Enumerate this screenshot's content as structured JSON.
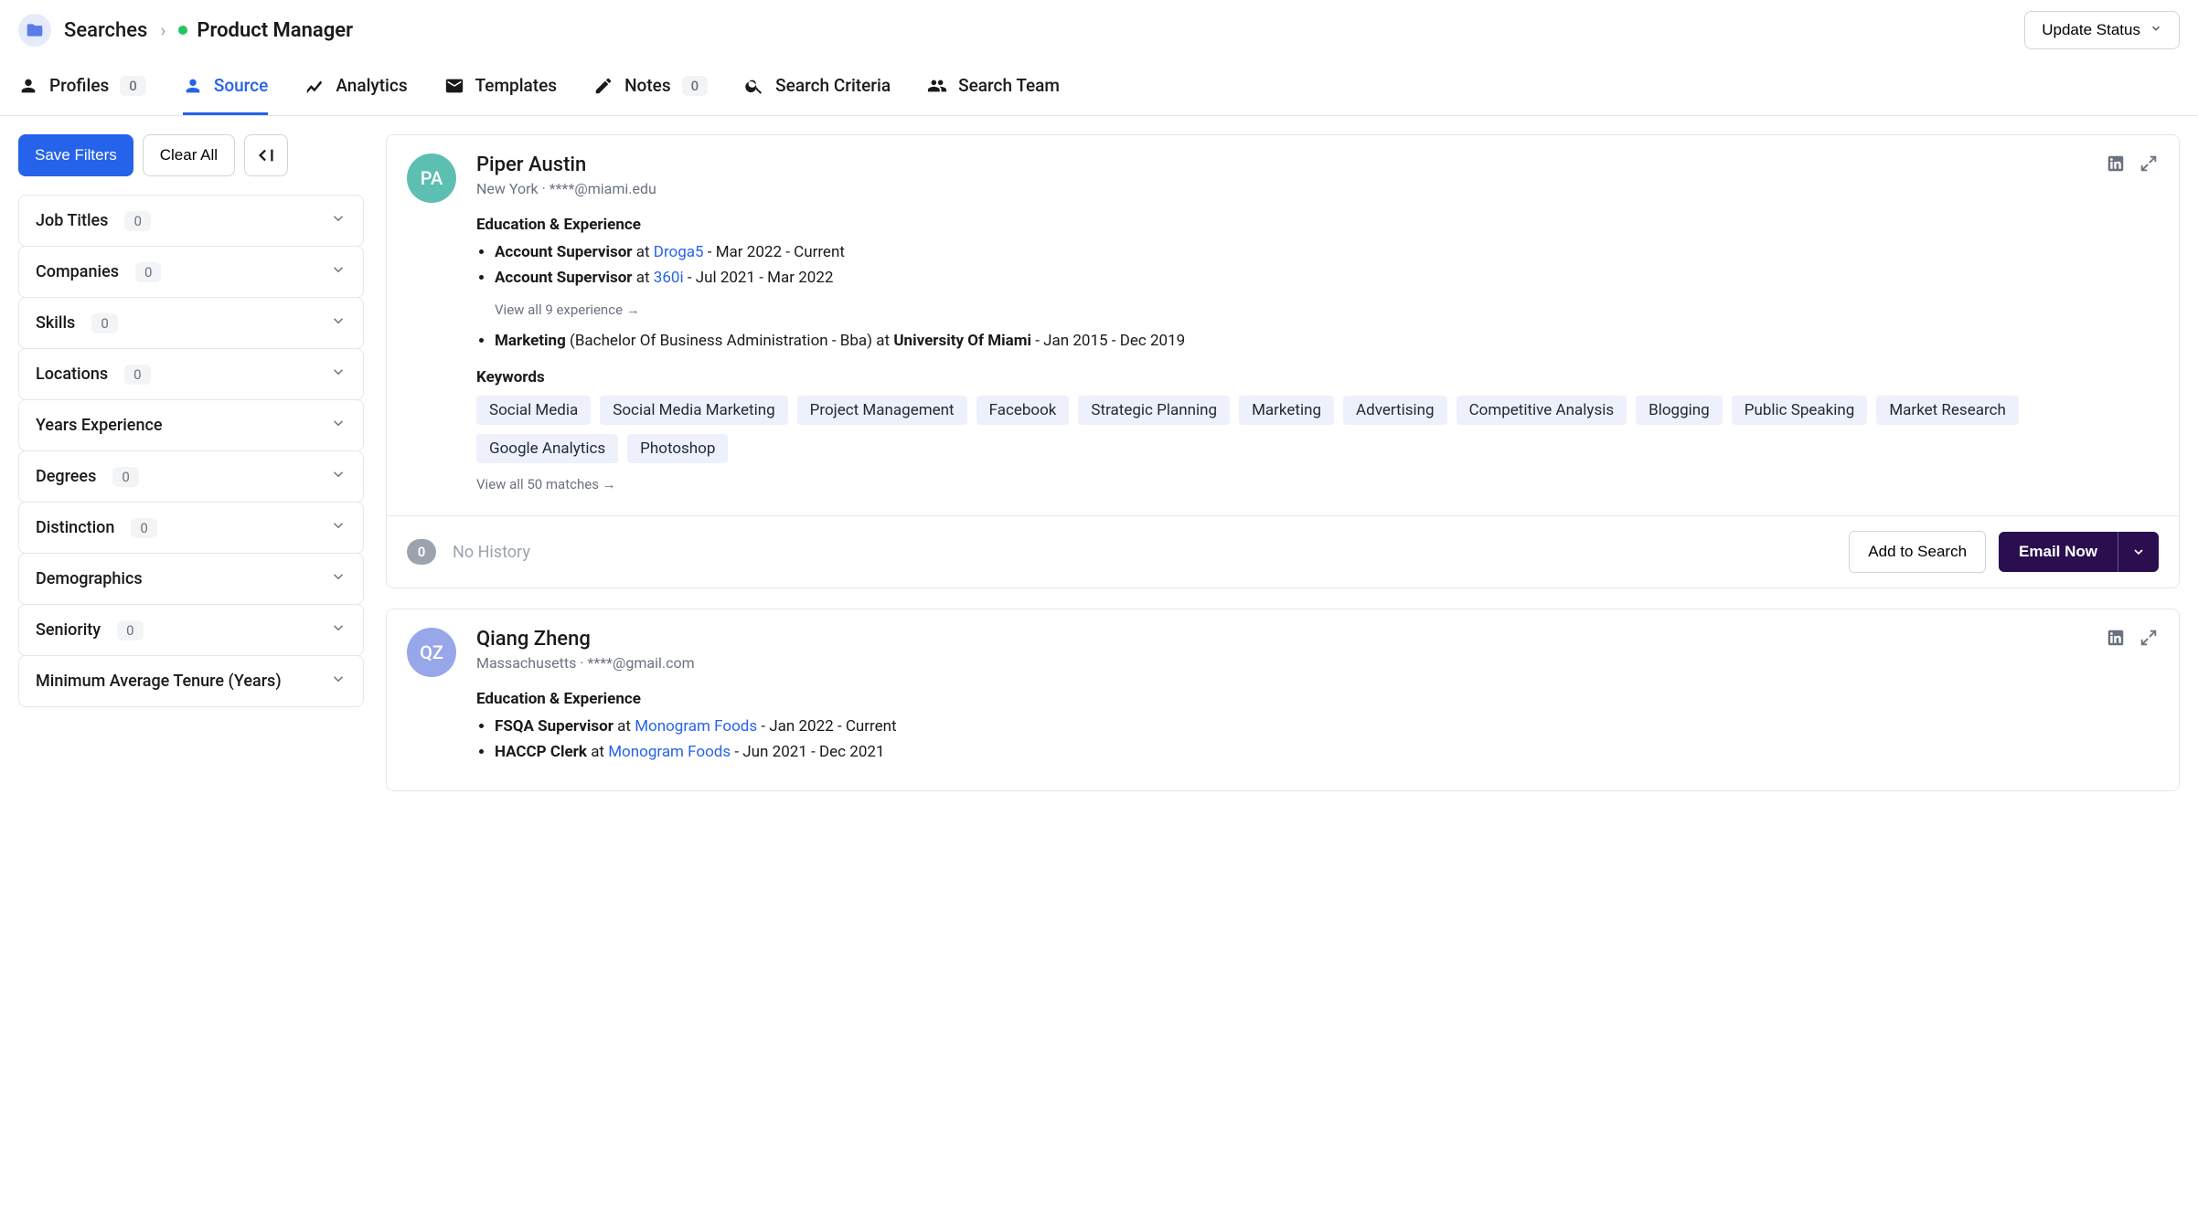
{
  "breadcrumb": {
    "root": "Searches",
    "leaf": "Product Manager"
  },
  "update_status_label": "Update Status",
  "tabs": [
    {
      "id": "profiles",
      "label": "Profiles",
      "count": "0"
    },
    {
      "id": "source",
      "label": "Source"
    },
    {
      "id": "analytics",
      "label": "Analytics"
    },
    {
      "id": "templates",
      "label": "Templates"
    },
    {
      "id": "notes",
      "label": "Notes",
      "count": "0"
    },
    {
      "id": "criteria",
      "label": "Search Criteria"
    },
    {
      "id": "team",
      "label": "Search Team"
    }
  ],
  "side": {
    "save_label": "Save Filters",
    "clear_label": "Clear All",
    "filters": [
      {
        "label": "Job Titles",
        "count": "0"
      },
      {
        "label": "Companies",
        "count": "0"
      },
      {
        "label": "Skills",
        "count": "0"
      },
      {
        "label": "Locations",
        "count": "0"
      },
      {
        "label": "Years Experience"
      },
      {
        "label": "Degrees",
        "count": "0"
      },
      {
        "label": "Distinction",
        "count": "0"
      },
      {
        "label": "Demographics"
      },
      {
        "label": "Seniority",
        "count": "0"
      },
      {
        "label": "Minimum Average Tenure (Years)"
      }
    ]
  },
  "labels": {
    "edu_exp": "Education & Experience",
    "keywords": "Keywords",
    "at": "at",
    "add_to_search": "Add to Search",
    "email_now": "Email Now",
    "no_history": "No History"
  },
  "cards": [
    {
      "initials": "PA",
      "avatar_class": "av-teal",
      "name": "Piper Austin",
      "loc": "New York",
      "email": "****@miami.edu",
      "exp": [
        {
          "role": "Account Supervisor",
          "company": "Droga5",
          "dates": "Mar 2022 - Current"
        },
        {
          "role": "Account Supervisor",
          "company": "360i",
          "dates": "Jul 2021 - Mar 2022"
        }
      ],
      "view_exp": "View all 9 experience →",
      "edu": {
        "field": "Marketing",
        "degree": "(Bachelor Of Business Administration - Bba) at",
        "school": "University Of Miami",
        "dates": "Jan 2015 - Dec 2019"
      },
      "keywords": [
        "Social Media",
        "Social Media Marketing",
        "Project Management",
        "Facebook",
        "Strategic Planning",
        "Marketing",
        "Advertising",
        "Competitive Analysis",
        "Blogging",
        "Public Speaking",
        "Market Research",
        "Google Analytics",
        "Photoshop"
      ],
      "view_kw": "View all 50 matches →",
      "history_count": "0"
    },
    {
      "initials": "QZ",
      "avatar_class": "av-blue",
      "name": "Qiang Zheng",
      "loc": "Massachusetts",
      "email": "****@gmail.com",
      "exp": [
        {
          "role": "FSQA Supervisor",
          "company": "Monogram Foods",
          "dates": "Jan 2022 - Current"
        },
        {
          "role": "HACCP Clerk",
          "company": "Monogram Foods",
          "dates": "Jun 2021 - Dec 2021"
        }
      ]
    }
  ]
}
